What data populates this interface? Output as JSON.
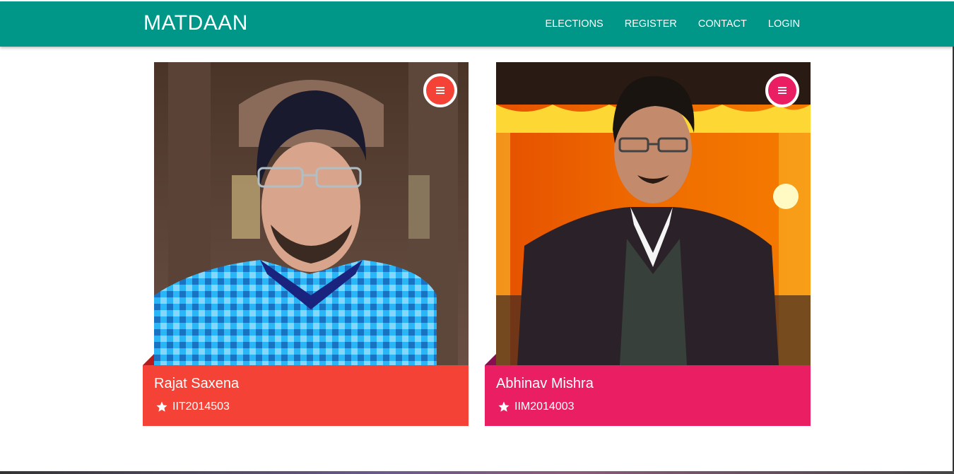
{
  "navbar": {
    "brand": "MATDAAN",
    "links": [
      "ELECTIONS",
      "REGISTER",
      "CONTACT",
      "LOGIN"
    ]
  },
  "candidates": [
    {
      "name": "Rajat Saxena",
      "id": "IIT2014503",
      "accent": "#f44336",
      "fold": "#b71c1c"
    },
    {
      "name": "Abhinav Mishra",
      "id": "IIM2014003",
      "accent": "#e91e63",
      "fold": "#880e4f"
    }
  ],
  "colors": {
    "navbar": "#009688"
  }
}
